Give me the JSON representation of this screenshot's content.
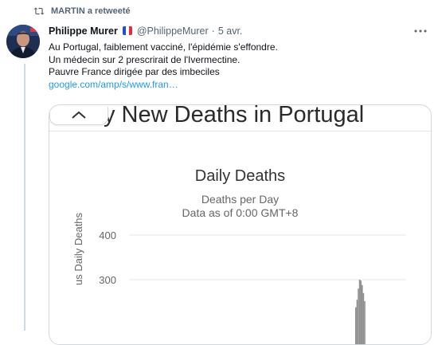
{
  "retweet": {
    "label": "MARTIN a retweeté",
    "icon": "retweet-icon"
  },
  "tweet": {
    "display_name": "Philippe Murer",
    "flag_icon": "france-flag-icon",
    "handle": "@PhilippeMurer",
    "separator": "·",
    "date": "5 avr.",
    "lines": [
      "Au Portugal, faiblement vacciné, l'épidémie s'effondre.",
      "Un médecin sur 2 prescrirait de l'Ivermectine.",
      "Pauvre France dirigée par des imbeciles"
    ],
    "link": "google.com/amp/s/www.fran…",
    "more_icon": "more-horizontal-icon"
  },
  "media": {
    "headline": "y New Deaths in Portugal",
    "chevron_icon": "chevron-up-icon"
  },
  "colors": {
    "link": "#1d9bf0",
    "secondary_text": "#536471",
    "bar": "#909090",
    "border": "#cfd9de"
  },
  "chart_data": {
    "type": "bar",
    "title": "Daily Deaths",
    "subtitle_lines": [
      "Deaths per Day",
      "Data as of 0:00 GMT+8"
    ],
    "ylabel": "us Daily Deaths",
    "yticks": [
      400,
      300
    ],
    "ylim": [
      240,
      410
    ],
    "grid": true,
    "spike_values": [
      238,
      255,
      280,
      300,
      298,
      288,
      270,
      252
    ]
  }
}
